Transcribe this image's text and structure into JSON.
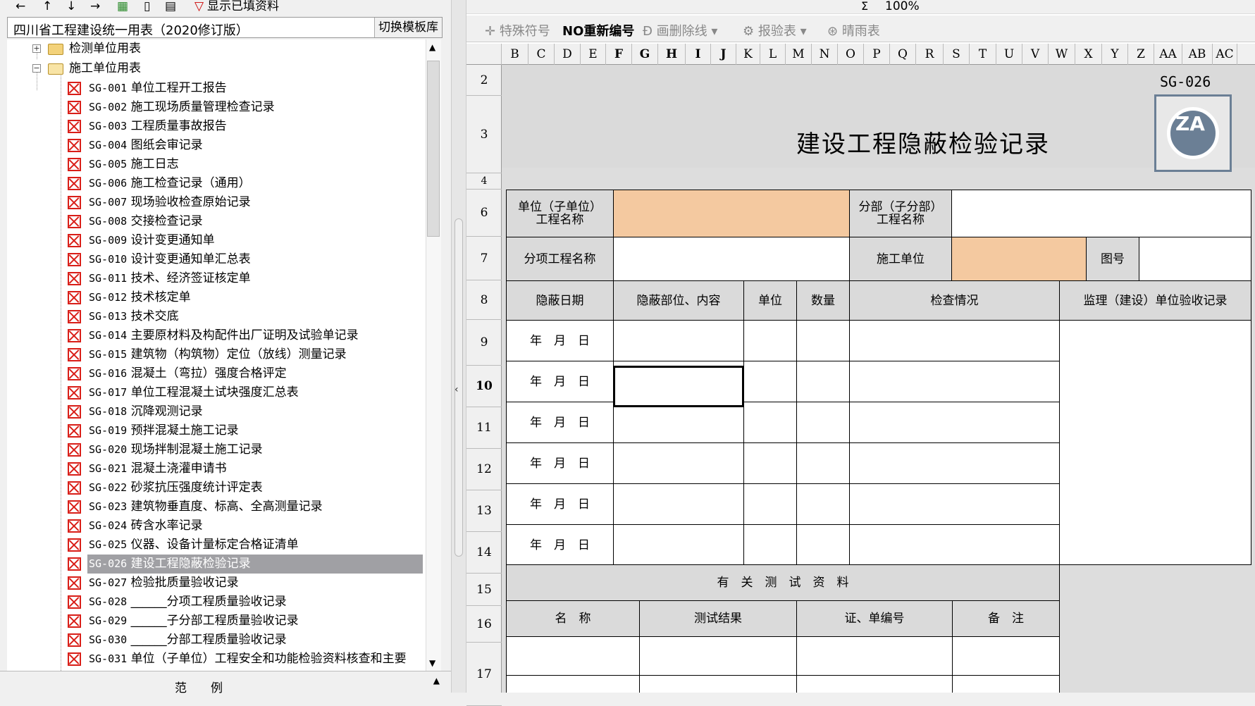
{
  "left_toolbar": {
    "items": [
      "◄",
      "▲",
      "▼",
      "►",
      "⊞",
      "📄",
      "📑"
    ],
    "show_filled_label": "显示已填资料"
  },
  "standard": {
    "name": "四川省工程建设统一用表（2020修订版）",
    "switch_button": "切换模板库"
  },
  "tree": {
    "folders": [
      {
        "label": "检测单位用表"
      },
      {
        "label": "施工单位用表"
      }
    ],
    "items": [
      {
        "code": "SG-001",
        "title": "单位工程开工报告"
      },
      {
        "code": "SG-002",
        "title": "施工现场质量管理检查记录"
      },
      {
        "code": "SG-003",
        "title": "工程质量事故报告"
      },
      {
        "code": "SG-004",
        "title": "图纸会审记录"
      },
      {
        "code": "SG-005",
        "title": "施工日志"
      },
      {
        "code": "SG-006",
        "title": "施工检查记录（通用）"
      },
      {
        "code": "SG-007",
        "title": "现场验收检查原始记录"
      },
      {
        "code": "SG-008",
        "title": "交接检查记录"
      },
      {
        "code": "SG-009",
        "title": "设计变更通知单"
      },
      {
        "code": "SG-010",
        "title": "设计变更通知单汇总表"
      },
      {
        "code": "SG-011",
        "title": "技术、经济签证核定单"
      },
      {
        "code": "SG-012",
        "title": "技术核定单"
      },
      {
        "code": "SG-013",
        "title": "技术交底"
      },
      {
        "code": "SG-014",
        "title": "主要原材料及构配件出厂证明及试验单记录"
      },
      {
        "code": "SG-015",
        "title": "建筑物（构筑物）定位（放线）测量记录"
      },
      {
        "code": "SG-016",
        "title": "混凝土（弯拉）强度合格评定"
      },
      {
        "code": "SG-017",
        "title": "单位工程混凝土试块强度汇总表"
      },
      {
        "code": "SG-018",
        "title": "沉降观测记录"
      },
      {
        "code": "SG-019",
        "title": "预拌混凝土施工记录"
      },
      {
        "code": "SG-020",
        "title": "现场拌制混凝土施工记录"
      },
      {
        "code": "SG-021",
        "title": "混凝土浇灌申请书"
      },
      {
        "code": "SG-022",
        "title": "砂浆抗压强度统计评定表"
      },
      {
        "code": "SG-023",
        "title": "建筑物垂直度、标高、全高测量记录"
      },
      {
        "code": "SG-024",
        "title": "砖含水率记录"
      },
      {
        "code": "SG-025",
        "title": "仪器、设备计量标定合格证清单"
      },
      {
        "code": "SG-026",
        "title": "建设工程隐蔽检验记录",
        "selected": true
      },
      {
        "code": "SG-027",
        "title": "检验批质量验收记录"
      },
      {
        "code": "SG-028",
        "title": "______分项工程质量验收记录"
      },
      {
        "code": "SG-029",
        "title": "______子分部工程质量验收记录"
      },
      {
        "code": "SG-030",
        "title": "______分部工程质量验收记录"
      },
      {
        "code": "SG-031",
        "title": "单位（子单位）工程安全和功能检验资料核查和主要"
      }
    ],
    "legend": "范例"
  },
  "right_toolbar": {
    "zoom": "100%",
    "special_symbol": "特殊符号",
    "renumber": "NO重新编号",
    "strike": "画删除线",
    "report": "报验表",
    "weather": "晴雨表"
  },
  "columns": [
    "B",
    "C",
    "D",
    "E",
    "F",
    "G",
    "H",
    "I",
    "J",
    "K",
    "L",
    "M",
    "N",
    "O",
    "P",
    "Q",
    "R",
    "S",
    "T",
    "U",
    "V",
    "W",
    "X",
    "Y",
    "Z",
    "AA",
    "AB",
    "AC"
  ],
  "rows": [
    "2",
    "3",
    "4",
    "6",
    "7",
    "8",
    "9",
    "10",
    "11",
    "12",
    "13",
    "14",
    "15",
    "16",
    "17"
  ],
  "form": {
    "code": "SG-026",
    "title": "建设工程隐蔽检验记录",
    "logo_text": "ZA",
    "unit_project_label": "单位（子单位）\n工程名称",
    "sub_division_label": "分部（子分部）\n工程名称",
    "item_project_label": "分项工程名称",
    "construction_unit_label": "施工单位",
    "drawing_no_label": "图号",
    "headers": [
      "隐蔽日期",
      "隐蔽部位、内容",
      "单位",
      "数量",
      "检查情况",
      "监理（建设）单位验收记录"
    ],
    "date_placeholder": "年　月　日",
    "test_section_title": "有　关　测　试　资　料",
    "test_headers": [
      "名　称",
      "测试结果",
      "证、单编号",
      "备　注"
    ]
  }
}
